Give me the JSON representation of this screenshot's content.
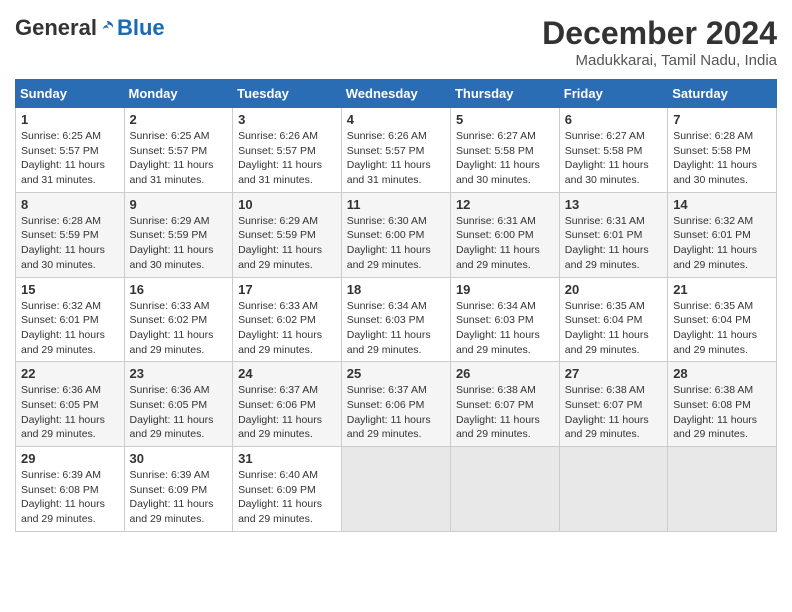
{
  "header": {
    "logo_general": "General",
    "logo_blue": "Blue",
    "month_title": "December 2024",
    "location": "Madukkarai, Tamil Nadu, India"
  },
  "calendar": {
    "days_of_week": [
      "Sunday",
      "Monday",
      "Tuesday",
      "Wednesday",
      "Thursday",
      "Friday",
      "Saturday"
    ],
    "weeks": [
      [
        {
          "day": "1",
          "sunrise": "6:25 AM",
          "sunset": "5:57 PM",
          "daylight": "11 hours and 31 minutes."
        },
        {
          "day": "2",
          "sunrise": "6:25 AM",
          "sunset": "5:57 PM",
          "daylight": "11 hours and 31 minutes."
        },
        {
          "day": "3",
          "sunrise": "6:26 AM",
          "sunset": "5:57 PM",
          "daylight": "11 hours and 31 minutes."
        },
        {
          "day": "4",
          "sunrise": "6:26 AM",
          "sunset": "5:57 PM",
          "daylight": "11 hours and 31 minutes."
        },
        {
          "day": "5",
          "sunrise": "6:27 AM",
          "sunset": "5:58 PM",
          "daylight": "11 hours and 30 minutes."
        },
        {
          "day": "6",
          "sunrise": "6:27 AM",
          "sunset": "5:58 PM",
          "daylight": "11 hours and 30 minutes."
        },
        {
          "day": "7",
          "sunrise": "6:28 AM",
          "sunset": "5:58 PM",
          "daylight": "11 hours and 30 minutes."
        }
      ],
      [
        {
          "day": "8",
          "sunrise": "6:28 AM",
          "sunset": "5:59 PM",
          "daylight": "11 hours and 30 minutes."
        },
        {
          "day": "9",
          "sunrise": "6:29 AM",
          "sunset": "5:59 PM",
          "daylight": "11 hours and 30 minutes."
        },
        {
          "day": "10",
          "sunrise": "6:29 AM",
          "sunset": "5:59 PM",
          "daylight": "11 hours and 29 minutes."
        },
        {
          "day": "11",
          "sunrise": "6:30 AM",
          "sunset": "6:00 PM",
          "daylight": "11 hours and 29 minutes."
        },
        {
          "day": "12",
          "sunrise": "6:31 AM",
          "sunset": "6:00 PM",
          "daylight": "11 hours and 29 minutes."
        },
        {
          "day": "13",
          "sunrise": "6:31 AM",
          "sunset": "6:01 PM",
          "daylight": "11 hours and 29 minutes."
        },
        {
          "day": "14",
          "sunrise": "6:32 AM",
          "sunset": "6:01 PM",
          "daylight": "11 hours and 29 minutes."
        }
      ],
      [
        {
          "day": "15",
          "sunrise": "6:32 AM",
          "sunset": "6:01 PM",
          "daylight": "11 hours and 29 minutes."
        },
        {
          "day": "16",
          "sunrise": "6:33 AM",
          "sunset": "6:02 PM",
          "daylight": "11 hours and 29 minutes."
        },
        {
          "day": "17",
          "sunrise": "6:33 AM",
          "sunset": "6:02 PM",
          "daylight": "11 hours and 29 minutes."
        },
        {
          "day": "18",
          "sunrise": "6:34 AM",
          "sunset": "6:03 PM",
          "daylight": "11 hours and 29 minutes."
        },
        {
          "day": "19",
          "sunrise": "6:34 AM",
          "sunset": "6:03 PM",
          "daylight": "11 hours and 29 minutes."
        },
        {
          "day": "20",
          "sunrise": "6:35 AM",
          "sunset": "6:04 PM",
          "daylight": "11 hours and 29 minutes."
        },
        {
          "day": "21",
          "sunrise": "6:35 AM",
          "sunset": "6:04 PM",
          "daylight": "11 hours and 29 minutes."
        }
      ],
      [
        {
          "day": "22",
          "sunrise": "6:36 AM",
          "sunset": "6:05 PM",
          "daylight": "11 hours and 29 minutes."
        },
        {
          "day": "23",
          "sunrise": "6:36 AM",
          "sunset": "6:05 PM",
          "daylight": "11 hours and 29 minutes."
        },
        {
          "day": "24",
          "sunrise": "6:37 AM",
          "sunset": "6:06 PM",
          "daylight": "11 hours and 29 minutes."
        },
        {
          "day": "25",
          "sunrise": "6:37 AM",
          "sunset": "6:06 PM",
          "daylight": "11 hours and 29 minutes."
        },
        {
          "day": "26",
          "sunrise": "6:38 AM",
          "sunset": "6:07 PM",
          "daylight": "11 hours and 29 minutes."
        },
        {
          "day": "27",
          "sunrise": "6:38 AM",
          "sunset": "6:07 PM",
          "daylight": "11 hours and 29 minutes."
        },
        {
          "day": "28",
          "sunrise": "6:38 AM",
          "sunset": "6:08 PM",
          "daylight": "11 hours and 29 minutes."
        }
      ],
      [
        {
          "day": "29",
          "sunrise": "6:39 AM",
          "sunset": "6:08 PM",
          "daylight": "11 hours and 29 minutes."
        },
        {
          "day": "30",
          "sunrise": "6:39 AM",
          "sunset": "6:09 PM",
          "daylight": "11 hours and 29 minutes."
        },
        {
          "day": "31",
          "sunrise": "6:40 AM",
          "sunset": "6:09 PM",
          "daylight": "11 hours and 29 minutes."
        },
        null,
        null,
        null,
        null
      ]
    ]
  }
}
